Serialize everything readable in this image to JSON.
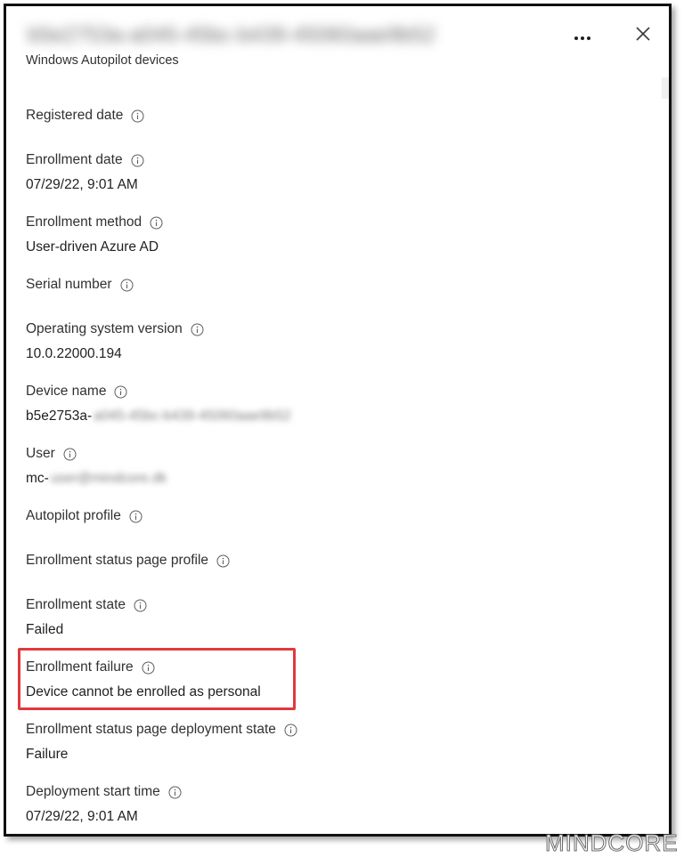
{
  "header": {
    "device_id": "b5e2753a-a045-45bc-b439-45060aae9b52",
    "subtitle": "Windows Autopilot devices",
    "more_icon": "more-options-icon",
    "close_icon": "close-icon"
  },
  "fields": [
    {
      "label": "Registered date",
      "value": ""
    },
    {
      "label": "Enrollment date",
      "value": "07/29/22, 9:01 AM"
    },
    {
      "label": "Enrollment method",
      "value": "User-driven Azure AD"
    },
    {
      "label": "Serial number",
      "value": ""
    },
    {
      "label": "Operating system version",
      "value": "10.0.22000.194"
    },
    {
      "label": "Device name",
      "value": "b5e2753a-",
      "value_redacted": "a045-45bc-b439-45060aae9b52"
    },
    {
      "label": "User",
      "value": "mc-",
      "value_redacted": "user@mindcore.dk"
    },
    {
      "label": "Autopilot profile",
      "value": ""
    },
    {
      "label": "Enrollment status page profile",
      "value": ""
    },
    {
      "label": "Enrollment state",
      "value": "Failed"
    },
    {
      "label": "Enrollment failure",
      "value": "Device cannot be enrolled as personal"
    },
    {
      "label": "Enrollment status page deployment state",
      "value": "Failure"
    },
    {
      "label": "Deployment start time",
      "value": "07/29/22, 9:01 AM"
    }
  ],
  "watermark": "MINDCORE",
  "colors": {
    "highlight": "#e0393e",
    "text": "#323130"
  }
}
